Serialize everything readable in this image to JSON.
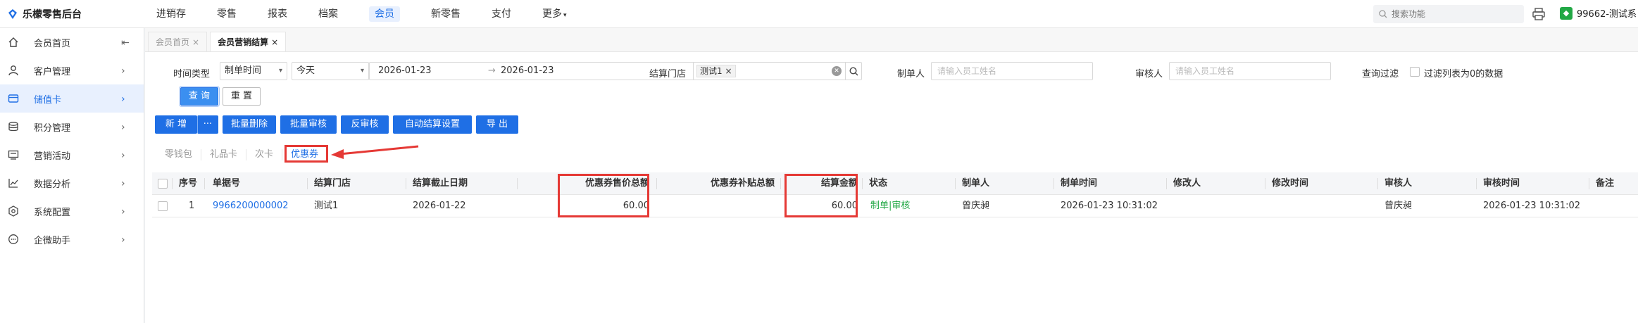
{
  "app": {
    "title": "乐檬零售后台"
  },
  "topnav": {
    "items": [
      "进销存",
      "零售",
      "报表",
      "档案",
      "会员",
      "新零售",
      "支付",
      "更多"
    ],
    "active": "会员",
    "search_placeholder": "搜索功能",
    "store_name": "99662-测试系"
  },
  "sidebar": {
    "items": [
      {
        "label": "会员首页",
        "icon": "home-icon"
      },
      {
        "label": "客户管理",
        "icon": "user-icon"
      },
      {
        "label": "储值卡",
        "icon": "card-icon"
      },
      {
        "label": "积分管理",
        "icon": "coins-icon"
      },
      {
        "label": "营销活动",
        "icon": "campaign-icon"
      },
      {
        "label": "数据分析",
        "icon": "chart-icon"
      },
      {
        "label": "系统配置",
        "icon": "settings-icon"
      },
      {
        "label": "企微助手",
        "icon": "chat-icon"
      }
    ],
    "active_index": 2,
    "collapse_glyph": "⇤"
  },
  "tabs": [
    {
      "label": "会员首页",
      "close": "×"
    },
    {
      "label": "会员营销结算",
      "close": "×"
    }
  ],
  "filters": {
    "time_type_label": "时间类型",
    "time_type_value": "制单时间",
    "period_value": "今天",
    "date_start": "2026-01-23",
    "date_sep": "→",
    "date_end": "2026-01-23",
    "store_label": "结算门店",
    "store_tag": "测试1",
    "store_tag_close": "×",
    "maker_label": "制单人",
    "maker_placeholder": "请输入员工姓名",
    "auditor_label": "审核人",
    "auditor_placeholder": "请输入员工姓名",
    "query_filter_label": "查询过滤",
    "filter_zero_label": "过滤列表为0的数据"
  },
  "buttons": {
    "query": "查 询",
    "reset": "重 置",
    "add": "新 增",
    "more": "···",
    "batch_delete": "批量删除",
    "batch_audit": "批量审核",
    "reverse_audit": "反审核",
    "auto_settle": "自动结算设置",
    "export": "导 出"
  },
  "subtabs": {
    "items": [
      "零钱包",
      "礼品卡",
      "次卡",
      "优惠券"
    ],
    "active_index": 3
  },
  "table": {
    "headers": [
      "序号",
      "单据号",
      "结算门店",
      "结算截止日期",
      "优惠券售价总额",
      "优惠券补贴总额",
      "结算金额",
      "状态",
      "制单人",
      "制单时间",
      "修改人",
      "修改时间",
      "审核人",
      "审核时间",
      "备注"
    ],
    "rows": [
      {
        "index": "1",
        "doc_no": "9966200000002",
        "store": "测试1",
        "deadline": "2026-01-22",
        "coupon_sale_total": "60.00",
        "coupon_subsidy_total": "",
        "settle_amount": "60.00",
        "status_text": "制单|审核",
        "maker": "曾庆昶",
        "make_time": "2026-01-23 10:31:02",
        "modifier": "",
        "modify_time": "",
        "auditor": "曾庆昶",
        "audit_time": "2026-01-23 10:31:02",
        "remark": ""
      }
    ]
  },
  "colors": {
    "primary": "#1f6fe5",
    "highlight": "#e53935",
    "status_green": "#22a845"
  }
}
